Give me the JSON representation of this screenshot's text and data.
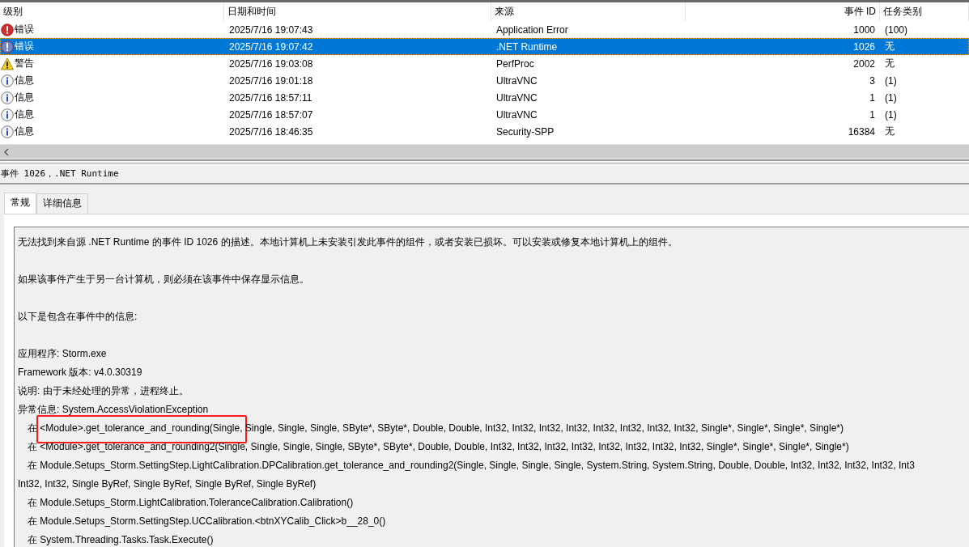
{
  "event_list": {
    "columns": [
      {
        "label": "级别"
      },
      {
        "label": "日期和时间"
      },
      {
        "label": "来源"
      },
      {
        "label": "事件 ID"
      },
      {
        "label": "任务类别"
      }
    ],
    "rows": [
      {
        "kind": "error",
        "level": "错误",
        "datetime": "2025/7/16 19:07:43",
        "source": "Application Error",
        "event_id": "1000",
        "task": "(100)",
        "selected": false
      },
      {
        "kind": "error",
        "level": "错误",
        "datetime": "2025/7/16 19:07:42",
        "source": ".NET Runtime",
        "event_id": "1026",
        "task": "无",
        "selected": true
      },
      {
        "kind": "warning",
        "level": "警告",
        "datetime": "2025/7/16 19:03:08",
        "source": "PerfProc",
        "event_id": "2002",
        "task": "无",
        "selected": false
      },
      {
        "kind": "info",
        "level": "信息",
        "datetime": "2025/7/16 19:01:18",
        "source": "UltraVNC",
        "event_id": "3",
        "task": "(1)",
        "selected": false
      },
      {
        "kind": "info",
        "level": "信息",
        "datetime": "2025/7/16 18:57:11",
        "source": "UltraVNC",
        "event_id": "1",
        "task": "(1)",
        "selected": false
      },
      {
        "kind": "info",
        "level": "信息",
        "datetime": "2025/7/16 18:57:07",
        "source": "UltraVNC",
        "event_id": "1",
        "task": "(1)",
        "selected": false
      },
      {
        "kind": "info",
        "level": "信息",
        "datetime": "2025/7/16 18:46:35",
        "source": "Security-SPP",
        "event_id": "16384",
        "task": "无",
        "selected": false
      }
    ]
  },
  "event_header": "事件 1026，.NET Runtime",
  "tabs": [
    {
      "label": "常规",
      "selected": true
    },
    {
      "label": "详细信息",
      "selected": false
    }
  ],
  "description": [
    {
      "kind": "paragraph",
      "text": "无法找到来自源 .NET Runtime 的事件 ID 1026 的描述。本地计算机上未安装引发此事件的组件，或者安装已损坏。可以安装或修复本地计算机上的组件。"
    },
    {
      "kind": "paragraph",
      "text": "如果该事件产生于另一台计算机，则必须在该事件中保存显示信息。"
    },
    {
      "kind": "paragraph",
      "text": "以下是包含在事件中的信息:"
    },
    {
      "kind": "line",
      "text": "应用程序: Storm.exe"
    },
    {
      "kind": "line",
      "text": "Framework 版本: v4.0.30319"
    },
    {
      "kind": "line",
      "text": "说明: 由于未经处理的异常，进程终止。"
    },
    {
      "kind": "line",
      "text": "异常信息: System.AccessViolationException"
    },
    {
      "kind": "trace",
      "text": "在 <Module>.get_tolerance_and_rounding(Single, Single, Single, Single, SByte*, SByte*, Double, Double, Int32, Int32, Int32, Int32, Int32, Int32, Int32, Int32, Single*, Single*, Single*, Single*)",
      "highlighted": true
    },
    {
      "kind": "trace",
      "text": "在 <Module>.get_tolerance_and_rounding2(Single, Single, Single, Single, SByte*, SByte*, Double, Double, Int32, Int32, Int32, Int32, Int32, Int32, Int32, Int32, Single*, Single*, Single*, Single*)",
      "highlighted": false
    },
    {
      "kind": "trace",
      "text": "在 Module.Setups_Storm.SettingStep.LightCalibration.DPCalibration.get_tolerance_and_rounding2(Single, Single, Single, Single, System.String, System.String, Double, Double, Int32, Int32, Int32, Int32, Int3",
      "highlighted": false
    },
    {
      "kind": "line",
      "text": "Int32, Int32, Single ByRef, Single ByRef, Single ByRef, Single ByRef)"
    },
    {
      "kind": "trace",
      "text": "在 Module.Setups_Storm.LightCalibration.ToleranceCalibration.Calibration()",
      "highlighted": false
    },
    {
      "kind": "trace",
      "text": "在 Module.Setups_Storm.SettingStep.UCCalibration.<btnXYCalib_Click>b__28_0()",
      "highlighted": false
    },
    {
      "kind": "trace",
      "text": "在 System.Threading.Tasks.Task.Execute()",
      "highlighted": false
    }
  ]
}
